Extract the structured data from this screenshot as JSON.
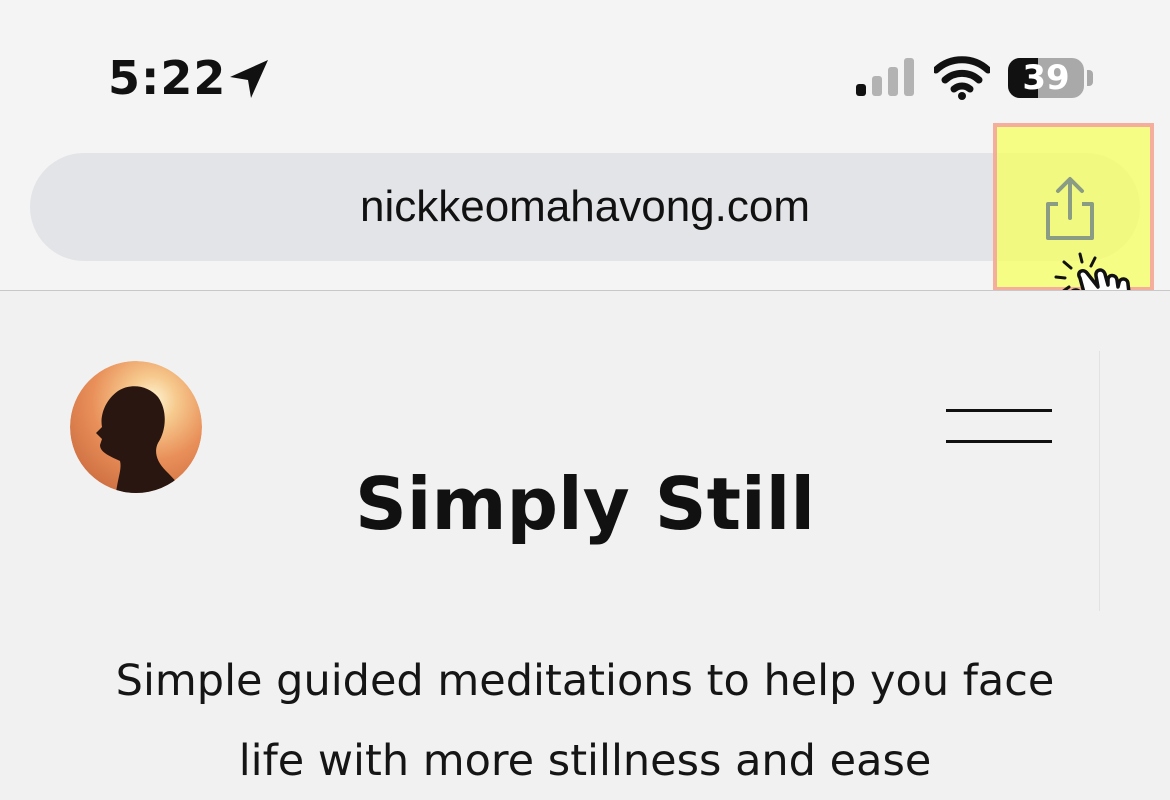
{
  "status_bar": {
    "time": "5:22",
    "battery_level": "39",
    "signal_bars_active": 1,
    "signal_bars_total": 4,
    "icons": [
      "location-arrow-icon",
      "cellular-signal-icon",
      "wifi-icon",
      "battery-icon"
    ]
  },
  "browser": {
    "url": "nickkeomahavong.com",
    "share_icon": "share-icon",
    "highlight_color": "#f5ff64",
    "tap_indicator": "hand-tap-icon"
  },
  "site": {
    "title": "Simply Still",
    "tagline_line1": "Simple guided meditations to help you face",
    "tagline_line2": "life with more stillness and ease",
    "menu_icon": "hamburger-menu-icon",
    "avatar": "silhouette-avatar"
  }
}
